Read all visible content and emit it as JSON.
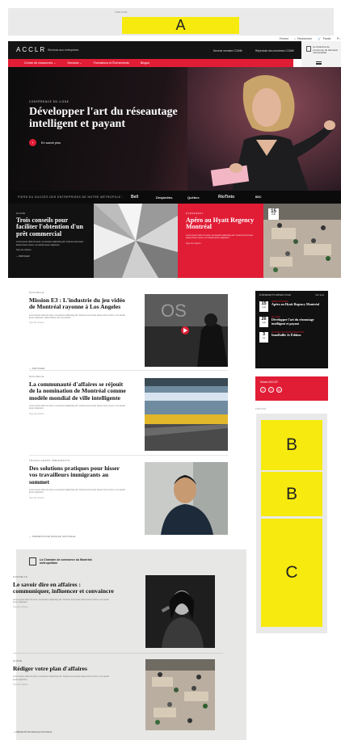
{
  "ad_top": {
    "label": "PUBLICITÉ",
    "placeholder": "A"
  },
  "utility": [
    {
      "icon": "",
      "label": "Fermer"
    },
    {
      "icon": "⌕",
      "label": "Rechercher"
    },
    {
      "icon": "🛒",
      "label": "Panier"
    },
    {
      "icon": "",
      "label": "Fr"
    }
  ],
  "header": {
    "logo": "ACCLR",
    "tagline": "Services aux entreprises",
    "links": [
      "Devenir membre CCMM",
      "Répertoire des membres CCMM"
    ],
    "ccmm": "La Chambre de commerce du Montréal métropolitain"
  },
  "nav": [
    "Centre de ressources",
    "Services",
    "Formations et Événements",
    "Blogue"
  ],
  "hero": {
    "kicker": "CONFÉRENCE EN LIGNE",
    "title": "Développer l'art du réseautage intelligent et payant",
    "cta": "En savoir plus"
  },
  "partners": {
    "lead": "FIERS DU SUCCÈS DES ENTREPRISES DE NOTRE MÉTROPOLE :",
    "logos": [
      "Bell",
      "Desjardins",
      "Québec",
      "RioTinto",
      "BDC"
    ]
  },
  "features": [
    {
      "kicker": "GUIDE",
      "title": "Trois conseils pour faciliter l'obtention d'un prêt commercial",
      "text": "Lorem ipsum dolor sit amet, consectetur adipiscing elit. Vivamus accumsan laoreet lorem luctus, non iaculis ipsum dignissim.",
      "link": "Type de contenu",
      "share": "PARTAGER"
    },
    {
      "kicker": "ÉVÉNEMENT",
      "title": "Apéro au Hyatt Regency Montréal",
      "text": "Lorem ipsum dolor sit amet, consectetur adipiscing elit. Vivamus accumsan laoreet lorem luctus, non iaculis ipsum dignissim.",
      "link": "Type de contenu",
      "day": "15",
      "month": "JUIN"
    }
  ],
  "articles": [
    {
      "kicker": "NOUVELLE",
      "title": "Mission E3 : L'industrie du jeu vidéo de Montréal rayonne à Los Angeles",
      "text": "Lorem ipsum dolor sit amet, consectetur adipiscing elit. Vivamus accumsan laoreet lorem luctus, non iaculis ipsum dignissim. Etiam finibus nisi vel pulvinar.",
      "link": "Type de contenu",
      "share": "PARTAGER"
    },
    {
      "kicker": "NOUVELLE",
      "title": "La communauté d'affaires se réjouit de la nomination de Montréal comme modèle mondial de ville intelligente",
      "text": "Lorem ipsum dolor sit amet, consectetur adipiscing elit. Vivamus accumsan laoreet lorem luctus, non iaculis ipsum dignissim.",
      "link": "Type de contenu"
    },
    {
      "kicker": "TRAVAILLEURS IMMIGRANTS",
      "title": "Des solutions pratiques pour hisser vos travailleurs immigrants au sommet",
      "text": "Lorem ipsum dolor sit amet, consectetur adipiscing elit. Vivamus accumsan laoreet lorem luctus, non iaculis ipsum dignissim.",
      "link": "Type de contenu",
      "share": "PRÉSENTÉ PAR BANQUE NATIONALE"
    }
  ],
  "sidebar": {
    "events_head": "ÉVÉNEMENTS RÉSEAUTAGE",
    "events_all": "Voir tous",
    "events": [
      {
        "day": "15",
        "month": "JUIN",
        "kind": "APÉRO MONTRÉAL",
        "title": "Apéro au Hyatt Regency Montréal"
      },
      {
        "day": "26",
        "month": "JUIN",
        "kind": "EN LIGNE",
        "title": "Développer l'art du réseautage intelligent et payant"
      },
      {
        "day": "3",
        "month": "JUIL",
        "kind": "LE GRAND SALON DE L'INNOVATION",
        "title": "InnoRallie 2e Édition"
      }
    ],
    "follow": "Suivez ACCLR",
    "social": [
      "t",
      "f",
      "in"
    ],
    "ad_label": "PUBLICITÉ",
    "ads": [
      "B",
      "B",
      "C"
    ]
  },
  "partner_block": {
    "org": "La Chambre de commerce du Montréal métropolitain",
    "articles": [
      {
        "kicker": "CONSEILS",
        "title": "Le savoir dire en affaires : communiquer, influencer et convaincre",
        "text": "Lorem ipsum dolor sit amet, consectetur adipiscing elit. Vivamus accumsan laoreet lorem luctus, non iaculis ipsum dignissim.",
        "link": "Type de contenu"
      },
      {
        "kicker": "GUIDE",
        "title": "Rédiger votre plan d'affaires",
        "text": "Lorem ipsum dolor sit amet, consectetur adipiscing elit. Vivamus accumsan laoreet lorem luctus, non iaculis ipsum dignissim.",
        "link": "Type de contenu"
      }
    ],
    "share": "PRÉSENTÉ PAR BANQUE NATIONALE"
  },
  "colors": {
    "accent": "#e11d36",
    "dark": "#141414",
    "ad": "#f6ea0f"
  }
}
